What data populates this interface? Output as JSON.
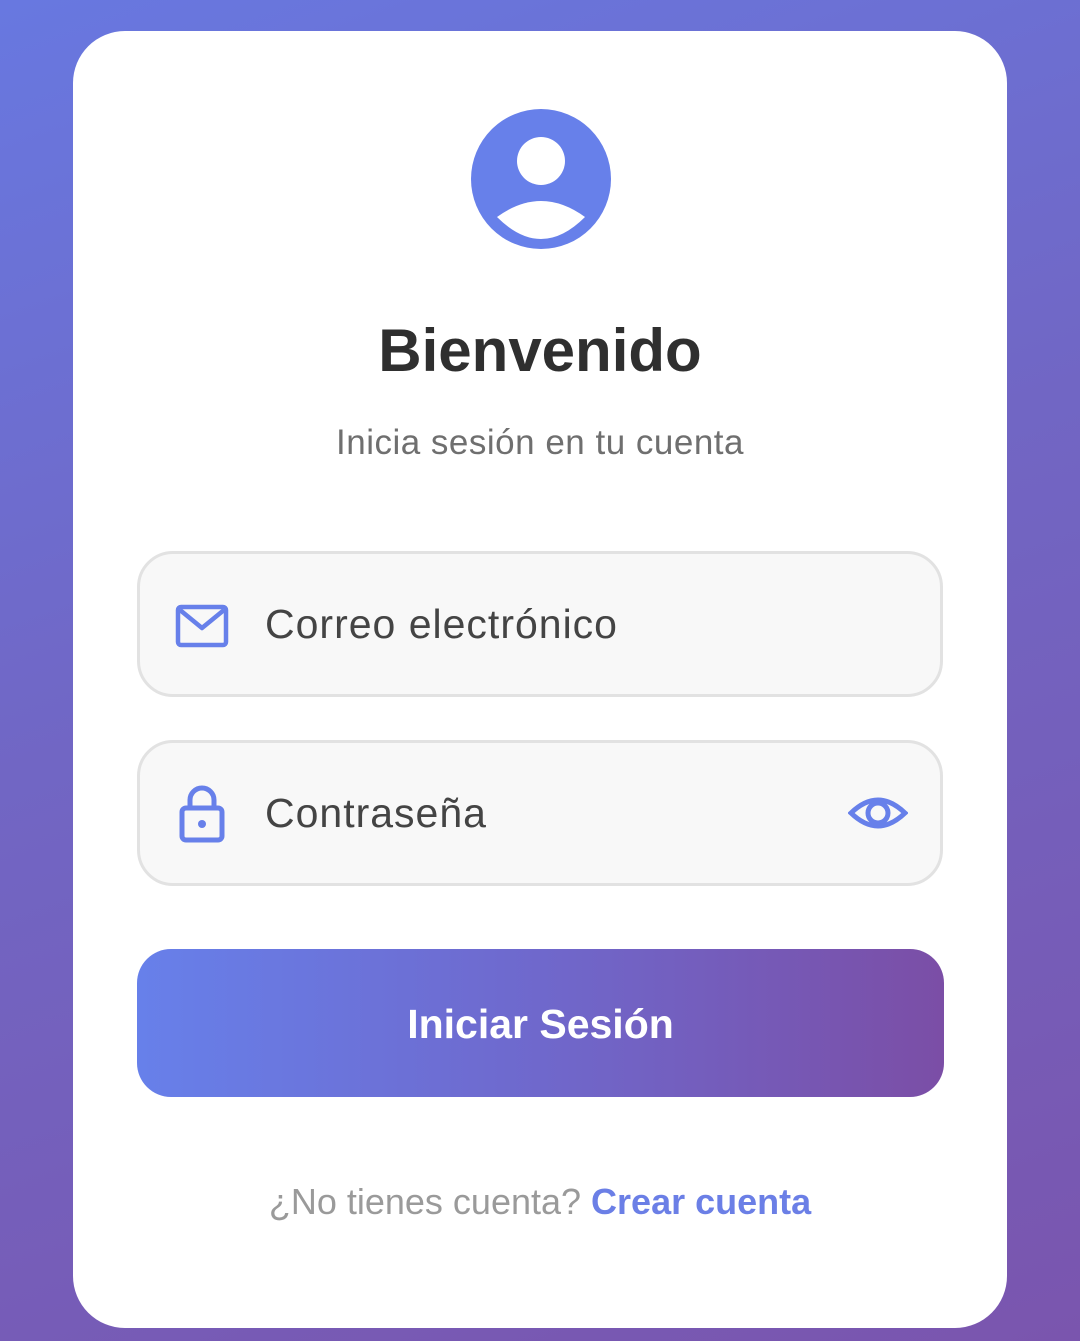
{
  "header": {
    "avatar_icon": "user-circle-icon",
    "title": "Bienvenido",
    "subtitle": "Inicia sesión en tu cuenta"
  },
  "form": {
    "email": {
      "icon": "mail-icon",
      "placeholder": "Correo electrónico",
      "value": ""
    },
    "password": {
      "icon": "lock-icon",
      "placeholder": "Contraseña",
      "value": "",
      "toggle_icon": "eye-icon"
    },
    "submit_label": "Iniciar Sesión"
  },
  "footer": {
    "question": "¿No tienes cuenta?",
    "link_label": "Crear cuenta"
  },
  "colors": {
    "accent": "#6b7fe6",
    "gradient_start": "#6780ea",
    "gradient_end": "#7b4ea6",
    "card": "#ffffff"
  }
}
